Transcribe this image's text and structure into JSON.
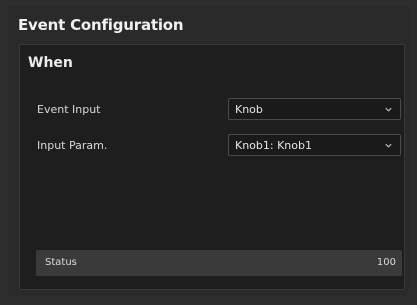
{
  "window": {
    "title": "Event Configuration"
  },
  "section": {
    "title": "When"
  },
  "fields": [
    {
      "label": "Event Input",
      "value": "Knob"
    },
    {
      "label": "Input Param.",
      "value": "Knob1: Knob1"
    }
  ],
  "status": {
    "label": "Status",
    "value": "100"
  },
  "icons": {
    "dropdown": "chevron-down-icon"
  },
  "colors": {
    "background": "#2a2a2a",
    "panel": "#1e1e1e",
    "status_bar": "#3a3a3a",
    "text": "#e6e6e6"
  }
}
